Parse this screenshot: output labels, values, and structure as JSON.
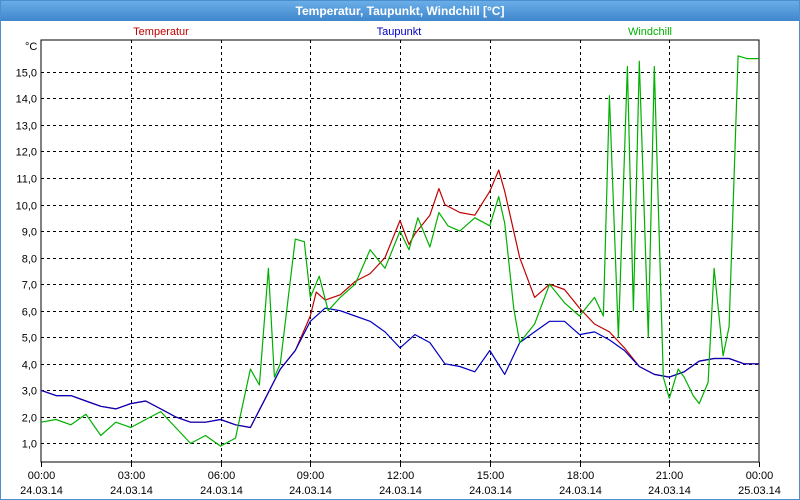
{
  "window_title": "Temperatur, Taupunkt, Windchill [°C]",
  "chart_data": {
    "type": "line",
    "title": "Temperatur, Taupunkt, Windchill [°C]",
    "ylabel": "°C",
    "xlabel": "",
    "xlim": [
      0,
      24
    ],
    "ylim": [
      0.3,
      16.2
    ],
    "grid": true,
    "legend": "top",
    "x_ticks": [
      0,
      3,
      6,
      9,
      12,
      15,
      18,
      21,
      24
    ],
    "x_tick_labels": [
      {
        "time": "00:00",
        "date": "24.03.14"
      },
      {
        "time": "03:00",
        "date": "24.03.14"
      },
      {
        "time": "06:00",
        "date": "24.03.14"
      },
      {
        "time": "09:00",
        "date": "24.03.14"
      },
      {
        "time": "12:00",
        "date": "24.03.14"
      },
      {
        "time": "15:00",
        "date": "24.03.14"
      },
      {
        "time": "18:00",
        "date": "24.03.14"
      },
      {
        "time": "21:00",
        "date": "24.03.14"
      },
      {
        "time": "00:00",
        "date": "25.03.14"
      }
    ],
    "y_ticks": [
      1,
      2,
      3,
      4,
      5,
      6,
      7,
      8,
      9,
      10,
      11,
      12,
      13,
      14,
      15
    ],
    "y_tick_labels": [
      "1,0",
      "2,0",
      "3,0",
      "4,0",
      "5,0",
      "6,0",
      "7,0",
      "8,0",
      "9,0",
      "10,0",
      "11,0",
      "12,0",
      "13,0",
      "14,0",
      "15,0"
    ],
    "series": [
      {
        "name": "Temperatur",
        "color": "#c00000",
        "x": [
          0,
          0.5,
          1,
          1.5,
          2,
          2.5,
          3,
          3.5,
          4,
          4.5,
          5,
          5.5,
          6,
          6.5,
          7,
          7.5,
          8,
          8.5,
          9,
          9.2,
          9.5,
          10,
          10.5,
          11,
          11.5,
          12,
          12.3,
          12.5,
          13,
          13.3,
          13.5,
          14,
          14.5,
          15,
          15.3,
          15.5,
          16,
          16.5,
          17,
          17.5,
          18,
          18.5,
          19,
          19.5,
          20,
          20.5,
          21,
          21.5,
          22,
          22.5,
          23,
          23.5,
          24
        ],
        "values": [
          3.0,
          2.8,
          2.8,
          2.6,
          2.4,
          2.3,
          2.5,
          2.6,
          2.3,
          2.0,
          1.8,
          1.8,
          1.9,
          1.7,
          1.6,
          2.7,
          3.8,
          4.5,
          5.8,
          6.7,
          6.4,
          6.6,
          7.1,
          7.4,
          8.0,
          9.4,
          8.5,
          8.9,
          9.6,
          10.6,
          10.0,
          9.7,
          9.6,
          10.5,
          11.3,
          10.5,
          8.0,
          6.5,
          7.0,
          6.8,
          6.1,
          5.5,
          5.2,
          4.6,
          3.9,
          3.6,
          3.5,
          3.7,
          4.1,
          4.2,
          4.2,
          4.0,
          4.0
        ]
      },
      {
        "name": "Taupunkt",
        "color": "#0000c0",
        "x": [
          0,
          0.5,
          1,
          1.5,
          2,
          2.5,
          3,
          3.5,
          4,
          4.5,
          5,
          5.5,
          6,
          6.5,
          7,
          7.5,
          8,
          8.5,
          9,
          9.5,
          10,
          10.5,
          11,
          11.5,
          12,
          12.5,
          13,
          13.5,
          14,
          14.5,
          15,
          15.5,
          16,
          16.5,
          17,
          17.5,
          18,
          18.5,
          19,
          19.5,
          20,
          20.5,
          21,
          21.5,
          22,
          22.5,
          23,
          23.5,
          24
        ],
        "values": [
          3.0,
          2.8,
          2.8,
          2.6,
          2.4,
          2.3,
          2.5,
          2.6,
          2.3,
          2.0,
          1.8,
          1.8,
          1.9,
          1.7,
          1.6,
          2.7,
          3.8,
          4.5,
          5.6,
          6.1,
          6.0,
          5.8,
          5.6,
          5.2,
          4.6,
          5.1,
          4.8,
          4.0,
          3.9,
          3.7,
          4.5,
          3.6,
          4.8,
          5.2,
          5.6,
          5.6,
          5.1,
          5.2,
          4.9,
          4.5,
          3.9,
          3.6,
          3.5,
          3.7,
          4.1,
          4.2,
          4.2,
          4.0,
          4.0
        ]
      },
      {
        "name": "Windchill",
        "color": "#00b000",
        "x": [
          0,
          0.5,
          1,
          1.5,
          2,
          2.5,
          3,
          3.5,
          4,
          4.5,
          5,
          5.5,
          6,
          6.5,
          7,
          7.3,
          7.6,
          7.8,
          8,
          8.5,
          8.8,
          9,
          9.3,
          9.6,
          10,
          10.5,
          11,
          11.5,
          12,
          12.3,
          12.6,
          13,
          13.3,
          13.6,
          14,
          14.5,
          15,
          15.3,
          15.5,
          15.8,
          16,
          16.5,
          17,
          17.5,
          18,
          18.5,
          18.8,
          19,
          19.3,
          19.6,
          19.8,
          20,
          20.3,
          20.5,
          20.8,
          21,
          21.3,
          21.5,
          21.8,
          22,
          22.3,
          22.5,
          22.8,
          23,
          23.3,
          23.6,
          24
        ],
        "values": [
          1.8,
          1.9,
          1.7,
          2.1,
          1.3,
          1.8,
          1.6,
          1.9,
          2.2,
          1.6,
          1.0,
          1.3,
          0.9,
          1.2,
          3.8,
          3.2,
          7.6,
          3.5,
          4.0,
          8.7,
          8.6,
          6.5,
          7.3,
          6.0,
          6.5,
          7.0,
          8.3,
          7.6,
          9.0,
          8.3,
          9.5,
          8.4,
          9.7,
          9.2,
          9.0,
          9.5,
          9.2,
          10.3,
          9.3,
          6.1,
          4.8,
          5.5,
          7.0,
          6.3,
          5.8,
          6.5,
          5.8,
          14.1,
          5.0,
          15.2,
          6.0,
          15.4,
          5.0,
          15.2,
          3.5,
          2.7,
          3.8,
          3.5,
          2.8,
          2.5,
          3.3,
          7.6,
          4.3,
          5.4,
          15.6,
          15.5,
          15.5
        ]
      }
    ]
  }
}
